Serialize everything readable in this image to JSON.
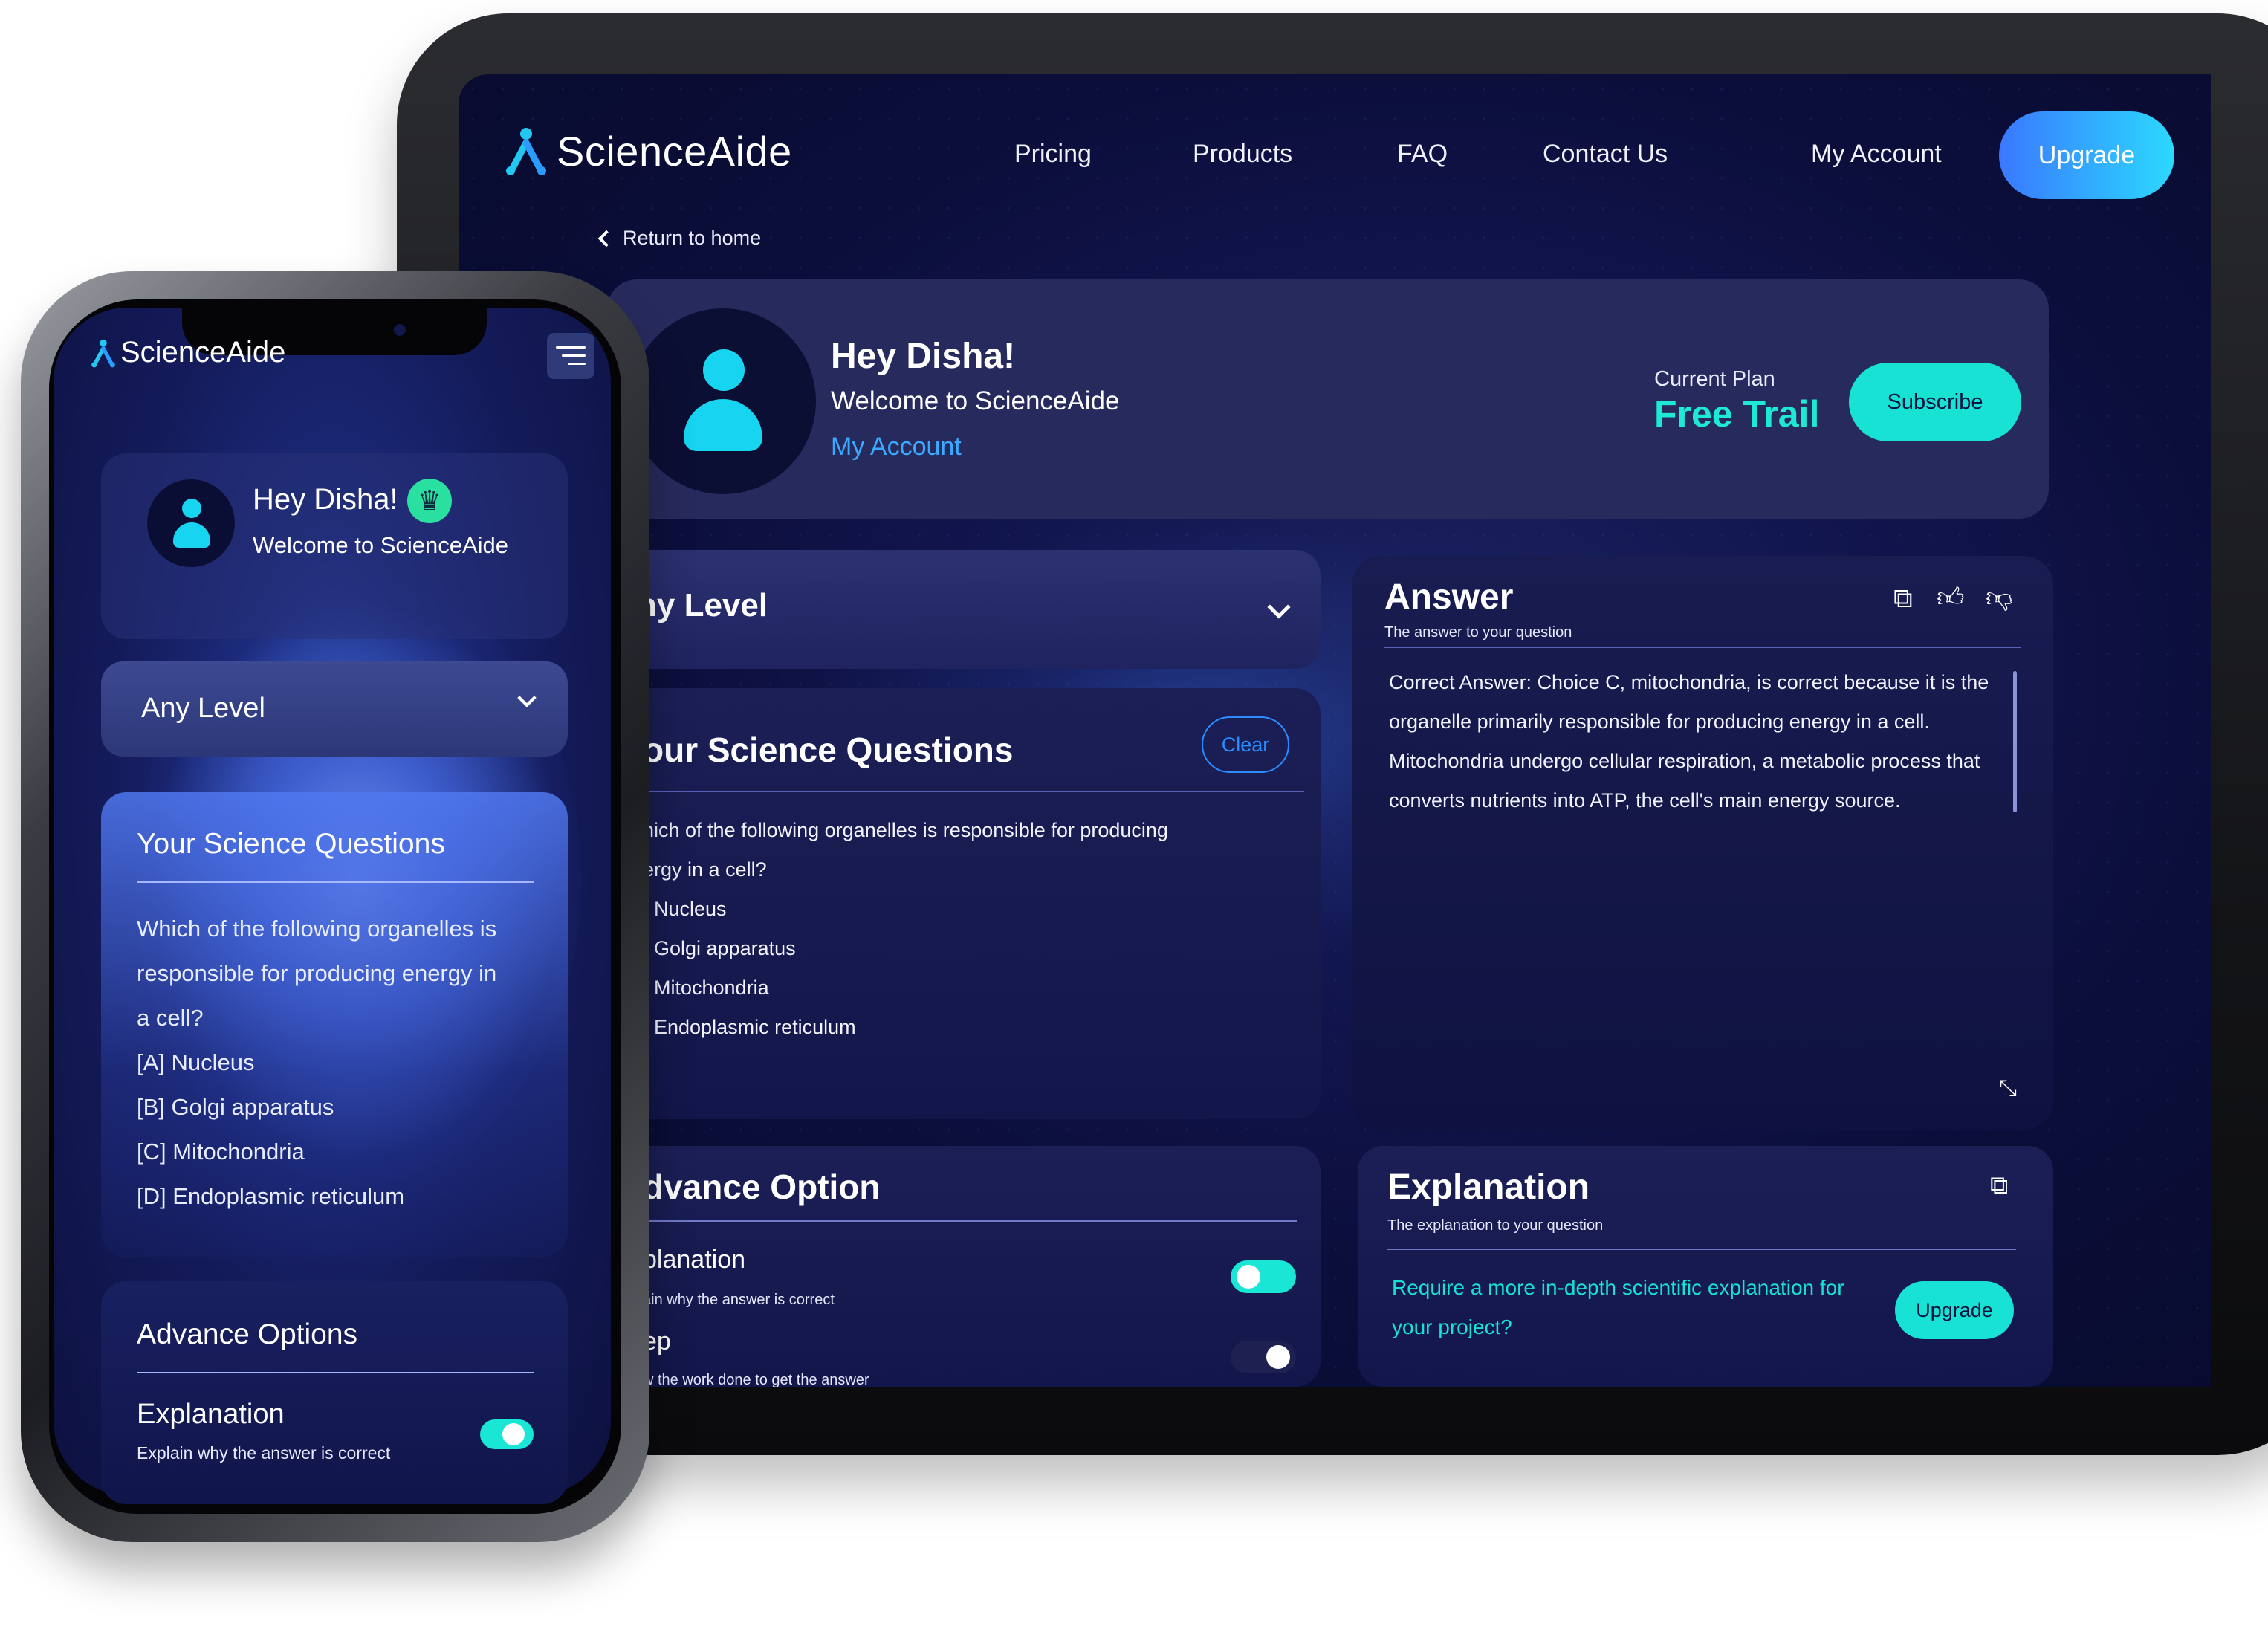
{
  "tablet": {
    "brand": "ScienceAide",
    "nav": [
      "Pricing",
      "Products",
      "FAQ",
      "Contact Us",
      "My Account"
    ],
    "upgrade_label": "Upgrade",
    "return_label": "Return to home",
    "profile": {
      "greeting": "Hey Disha!",
      "welcome": "Welcome to ScienceAide",
      "my_account": "My Account",
      "plan_label": "Current Plan",
      "plan_value": "Free Trail",
      "subscribe_label": "Subscribe"
    },
    "level_label": "ny Level",
    "questions": {
      "title": "our Science Questions",
      "clear_label": "Clear",
      "lines": [
        "hich of the following organelles is responsible for producing",
        "ergy in a cell?",
        "]  Nucleus",
        "] Golgi apparatus",
        "] Mitochondria",
        "] Endoplasmic reticulum"
      ]
    },
    "answer": {
      "title": "Answer",
      "subtitle": "The answer to your question",
      "text": "Correct Answer: Choice C, mitochondria, is correct because it is the organelle primarily responsible for producing energy in a cell. Mitochondria undergo cellular respiration, a metabolic process that converts nutrients into ATP, the cell's main energy source.",
      "icons": [
        "copy-icon",
        "thumbs-up-icon",
        "thumbs-down-icon",
        "resize-icon"
      ]
    },
    "advance": {
      "title": "dvance Option",
      "explanation_label": "planation",
      "explanation_sub": "ain why the answer is correct",
      "explanation_on": true,
      "step_label": "ep",
      "step_sub": "w the work done to get the answer",
      "step_on": false
    },
    "explanation": {
      "title": "Explanation",
      "subtitle": "The explanation to your question",
      "prompt": "Require a more in-depth scientific explanation for your project?",
      "upgrade_label": "Upgrade"
    }
  },
  "phone": {
    "brand": "ScienceAide",
    "greeting": "Hey Disha!",
    "welcome": "Welcome to ScienceAide",
    "level_label": "Any Level",
    "questions": {
      "title": "Your Science Questions",
      "lines": [
        "Which of the following organelles is",
        "responsible for producing energy in",
        "a cell?",
        "[A]  Nucleus",
        "[B] Golgi apparatus",
        "[C] Mitochondria",
        "[D] Endoplasmic reticulum"
      ]
    },
    "advance": {
      "title": "Advance Options",
      "explanation_label": "Explanation",
      "explanation_sub": "Explain why the answer is correct",
      "explanation_on": true
    }
  },
  "colors": {
    "accent": "#18e2d4",
    "link": "#3aa9ff",
    "screen_bg": "#0b0e3a"
  }
}
